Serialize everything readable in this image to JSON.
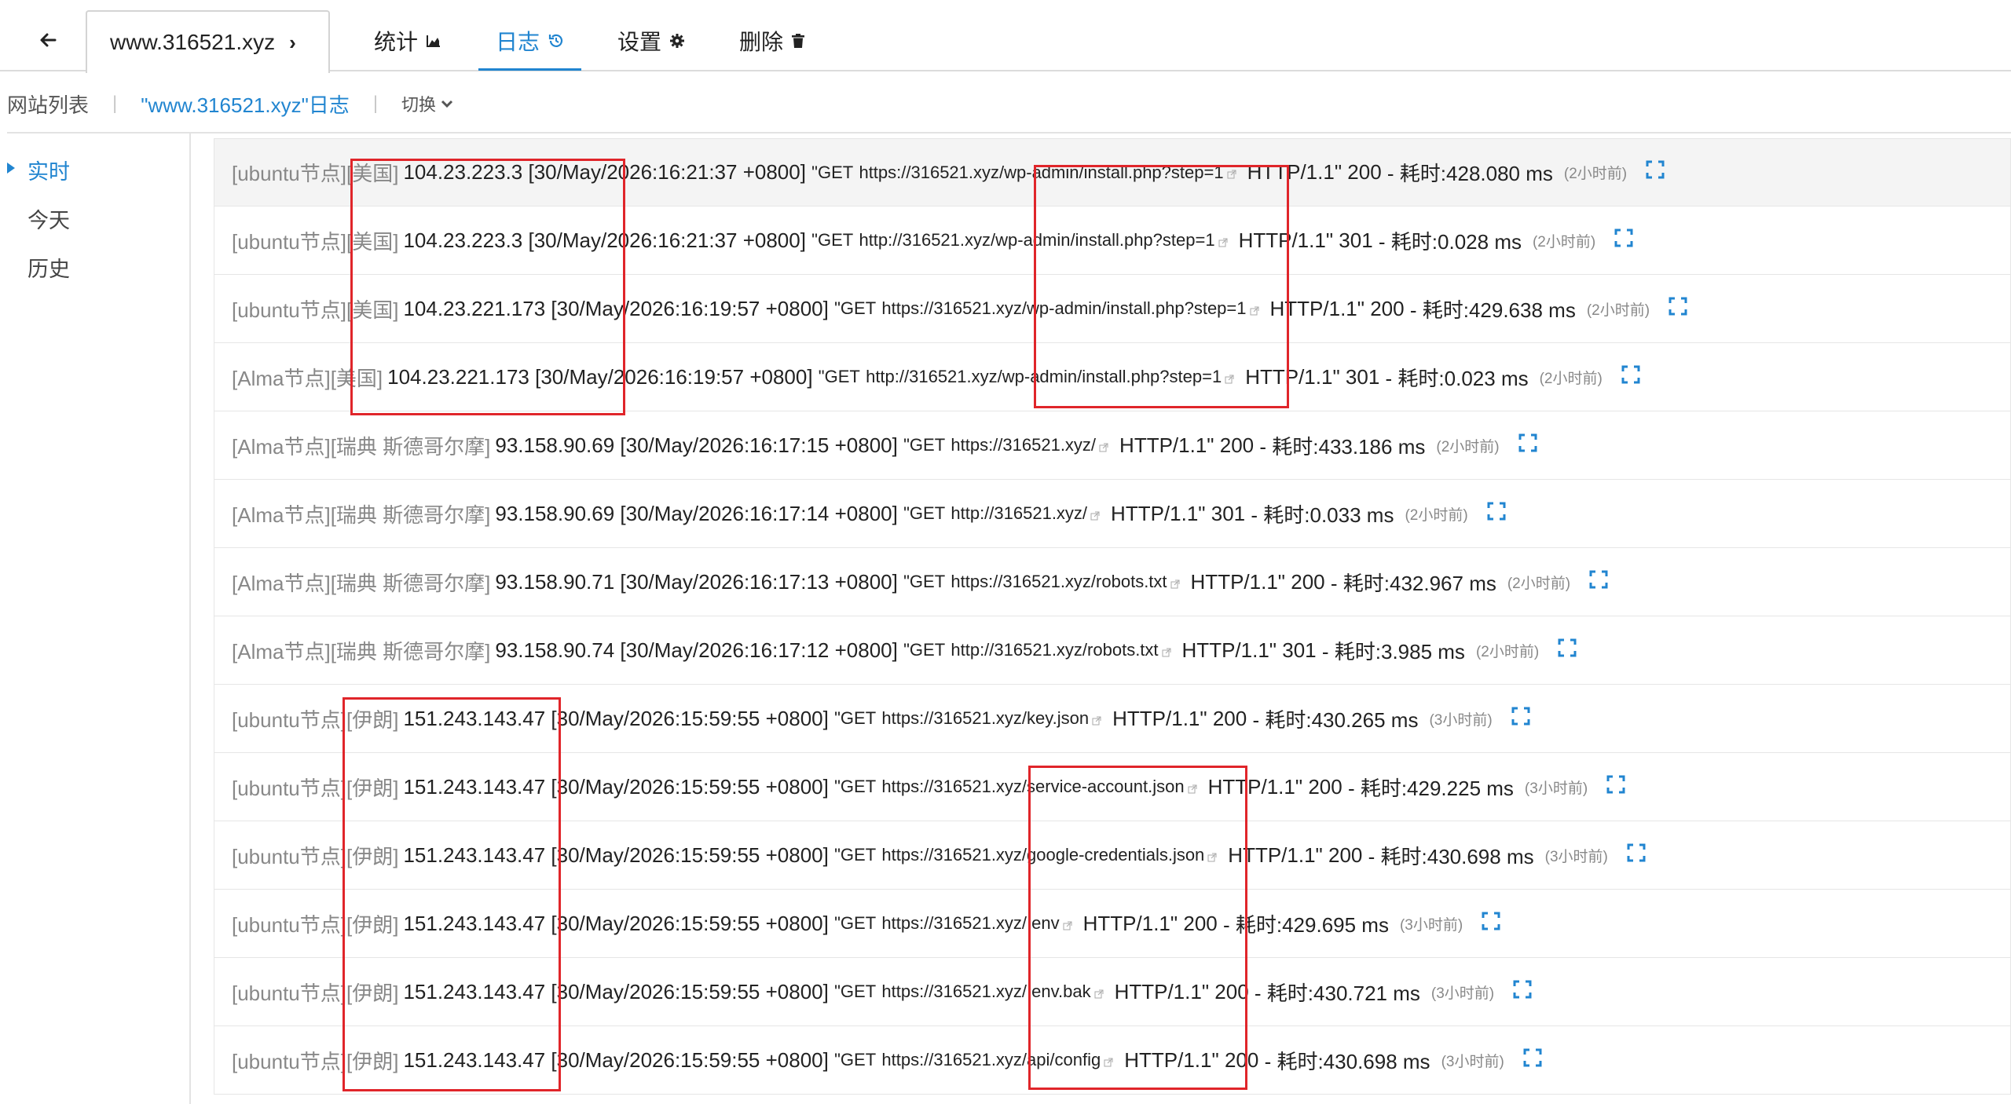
{
  "header": {
    "site_tab_label": "www.316521.xyz",
    "tabs": [
      {
        "label": "统计",
        "icon": "area-chart-icon"
      },
      {
        "label": "日志",
        "icon": "history-icon",
        "active": true
      },
      {
        "label": "设置",
        "icon": "gear-icon"
      },
      {
        "label": "删除",
        "icon": "trash-icon"
      }
    ]
  },
  "breadcrumb": {
    "site_list": "网站列表",
    "current": "\"www.316521.xyz\"日志",
    "switch_label": "切换"
  },
  "sidebar": {
    "items": [
      {
        "label": "实时",
        "active": true
      },
      {
        "label": "今天"
      },
      {
        "label": "历史"
      }
    ]
  },
  "logs": [
    {
      "node": "[ubuntu节点]",
      "region": "[美国]",
      "ip": "104.23.223.3",
      "time": "[30/May/2026:16:21:37 +0800]",
      "method": "\"GET",
      "url": "https://316521.xyz/wp-admin/install.php?step=1",
      "proto": "HTTP/1.1\"",
      "status": "200",
      "cost": "- 耗时:428.080 ms",
      "ago": "(2小时前)"
    },
    {
      "node": "[ubuntu节点]",
      "region": "[美国]",
      "ip": "104.23.223.3",
      "time": "[30/May/2026:16:21:37 +0800]",
      "method": "\"GET",
      "url": "http://316521.xyz/wp-admin/install.php?step=1",
      "proto": "HTTP/1.1\"",
      "status": "301",
      "cost": "- 耗时:0.028 ms",
      "ago": "(2小时前)"
    },
    {
      "node": "[ubuntu节点]",
      "region": "[美国]",
      "ip": "104.23.221.173",
      "time": "[30/May/2026:16:19:57 +0800]",
      "method": "\"GET",
      "url": "https://316521.xyz/wp-admin/install.php?step=1",
      "proto": "HTTP/1.1\"",
      "status": "200",
      "cost": "- 耗时:429.638 ms",
      "ago": "(2小时前)"
    },
    {
      "node": "[Alma节点]",
      "region": "[美国]",
      "ip": "104.23.221.173",
      "time": "[30/May/2026:16:19:57 +0800]",
      "method": "\"GET",
      "url": "http://316521.xyz/wp-admin/install.php?step=1",
      "proto": "HTTP/1.1\"",
      "status": "301",
      "cost": "- 耗时:0.023 ms",
      "ago": "(2小时前)"
    },
    {
      "node": "[Alma节点]",
      "region": "[瑞典 斯德哥尔摩]",
      "ip": "93.158.90.69",
      "time": "[30/May/2026:16:17:15 +0800]",
      "method": "\"GET",
      "url": "https://316521.xyz/",
      "proto": "HTTP/1.1\"",
      "status": "200",
      "cost": "- 耗时:433.186 ms",
      "ago": "(2小时前)"
    },
    {
      "node": "[Alma节点]",
      "region": "[瑞典 斯德哥尔摩]",
      "ip": "93.158.90.69",
      "time": "[30/May/2026:16:17:14 +0800]",
      "method": "\"GET",
      "url": "http://316521.xyz/",
      "proto": "HTTP/1.1\"",
      "status": "301",
      "cost": "- 耗时:0.033 ms",
      "ago": "(2小时前)"
    },
    {
      "node": "[Alma节点]",
      "region": "[瑞典 斯德哥尔摩]",
      "ip": "93.158.90.71",
      "time": "[30/May/2026:16:17:13 +0800]",
      "method": "\"GET",
      "url": "https://316521.xyz/robots.txt",
      "proto": "HTTP/1.1\"",
      "status": "200",
      "cost": "- 耗时:432.967 ms",
      "ago": "(2小时前)"
    },
    {
      "node": "[Alma节点]",
      "region": "[瑞典 斯德哥尔摩]",
      "ip": "93.158.90.74",
      "time": "[30/May/2026:16:17:12 +0800]",
      "method": "\"GET",
      "url": "http://316521.xyz/robots.txt",
      "proto": "HTTP/1.1\"",
      "status": "301",
      "cost": "- 耗时:3.985 ms",
      "ago": "(2小时前)"
    },
    {
      "node": "[ubuntu节点]",
      "region": "[伊朗]",
      "ip": "151.243.143.47",
      "time": "[30/May/2026:15:59:55 +0800]",
      "method": "\"GET",
      "url": "https://316521.xyz/key.json",
      "proto": "HTTP/1.1\"",
      "status": "200",
      "cost": "- 耗时:430.265 ms",
      "ago": "(3小时前)"
    },
    {
      "node": "[ubuntu节点]",
      "region": "[伊朗]",
      "ip": "151.243.143.47",
      "time": "[30/May/2026:15:59:55 +0800]",
      "method": "\"GET",
      "url": "https://316521.xyz/service-account.json",
      "proto": "HTTP/1.1\"",
      "status": "200",
      "cost": "- 耗时:429.225 ms",
      "ago": "(3小时前)"
    },
    {
      "node": "[ubuntu节点]",
      "region": "[伊朗]",
      "ip": "151.243.143.47",
      "time": "[30/May/2026:15:59:55 +0800]",
      "method": "\"GET",
      "url": "https://316521.xyz/google-credentials.json",
      "proto": "HTTP/1.1\"",
      "status": "200",
      "cost": "- 耗时:430.698 ms",
      "ago": "(3小时前)"
    },
    {
      "node": "[ubuntu节点]",
      "region": "[伊朗]",
      "ip": "151.243.143.47",
      "time": "[30/May/2026:15:59:55 +0800]",
      "method": "\"GET",
      "url": "https://316521.xyz/.env",
      "proto": "HTTP/1.1\"",
      "status": "200",
      "cost": "- 耗时:429.695 ms",
      "ago": "(3小时前)"
    },
    {
      "node": "[ubuntu节点]",
      "region": "[伊朗]",
      "ip": "151.243.143.47",
      "time": "[30/May/2026:15:59:55 +0800]",
      "method": "\"GET",
      "url": "https://316521.xyz/.env.bak",
      "proto": "HTTP/1.1\"",
      "status": "200",
      "cost": "- 耗时:430.721 ms",
      "ago": "(3小时前)"
    },
    {
      "node": "[ubuntu节点]",
      "region": "[伊朗]",
      "ip": "151.243.143.47",
      "time": "[30/May/2026:15:59:55 +0800]",
      "method": "\"GET",
      "url": "https://316521.xyz/api/config",
      "proto": "HTTP/1.1\"",
      "status": "200",
      "cost": "- 耗时:430.698 ms",
      "ago": "(3小时前)"
    }
  ],
  "colors": {
    "accent": "#2185d0",
    "highlight": "#e0252a",
    "muted": "#888888"
  }
}
